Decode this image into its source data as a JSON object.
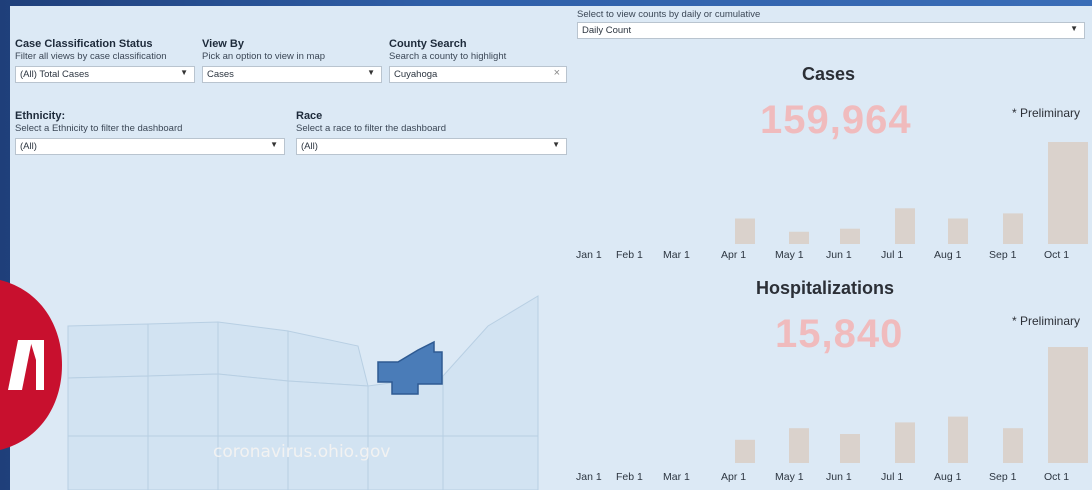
{
  "filters": {
    "case_classification": {
      "title": "Case Classification Status",
      "subtitle": "Filter all views by case classification",
      "value": "(All) Total Cases"
    },
    "view_by": {
      "title": "View By",
      "subtitle": "Pick an option to view in map",
      "value": "Cases"
    },
    "county_search": {
      "title": "County Search",
      "subtitle": "Search a county to highlight",
      "value": "Cuyahoga"
    },
    "ethnicity": {
      "title": "Ethnicity:",
      "subtitle": "Select a Ethnicity  to filter the dashboard",
      "value": "(All)"
    },
    "race": {
      "title": "Race",
      "subtitle": "Select a race to filter the dashboard",
      "value": "(All)"
    },
    "count_mode": {
      "subtitle": "Select to view counts by daily or cumulative",
      "value": "Daily Count"
    }
  },
  "icons": {
    "dropdown": "chevron-down-icon",
    "clear": "clear-x-icon"
  },
  "watermark": "coronavirus.ohio.gov",
  "colors": {
    "highlight_county": "#4a7cb8",
    "big_number": "#f4b4b4",
    "bars": "#d9c9be",
    "background": "#dce9f5"
  },
  "chart_data": [
    {
      "type": "bar",
      "title": "Cases",
      "total_label": "159,964",
      "note": "* Preliminary",
      "x_ticks": [
        "Jan 1",
        "Feb 1",
        "Mar 1",
        "Apr 1",
        "May 1",
        "Jun 1",
        "Jul 1",
        "Aug 1",
        "Sep 1",
        "Oct 1"
      ],
      "x": [
        "Jan",
        "Feb",
        "Mar",
        "Apr",
        "May",
        "Jun",
        "Jul",
        "Aug",
        "Sep",
        "Oct"
      ],
      "values": [
        0,
        0,
        0,
        0.25,
        0.12,
        0.15,
        0.35,
        0.25,
        0.3,
        1.0
      ],
      "grid": false,
      "legend": "none"
    },
    {
      "type": "bar",
      "title": "Hospitalizations",
      "total_label": "15,840",
      "note": "* Preliminary",
      "x_ticks": [
        "Jan 1",
        "Feb 1",
        "Mar 1",
        "Apr 1",
        "May 1",
        "Jun 1",
        "Jul 1",
        "Aug 1",
        "Sep 1",
        "Oct 1"
      ],
      "x": [
        "Jan",
        "Feb",
        "Mar",
        "Apr",
        "May",
        "Jun",
        "Jul",
        "Aug",
        "Sep",
        "Oct"
      ],
      "values": [
        0,
        0,
        0,
        0.2,
        0.3,
        0.25,
        0.35,
        0.4,
        0.3,
        1.0
      ],
      "grid": false,
      "legend": "none"
    }
  ]
}
